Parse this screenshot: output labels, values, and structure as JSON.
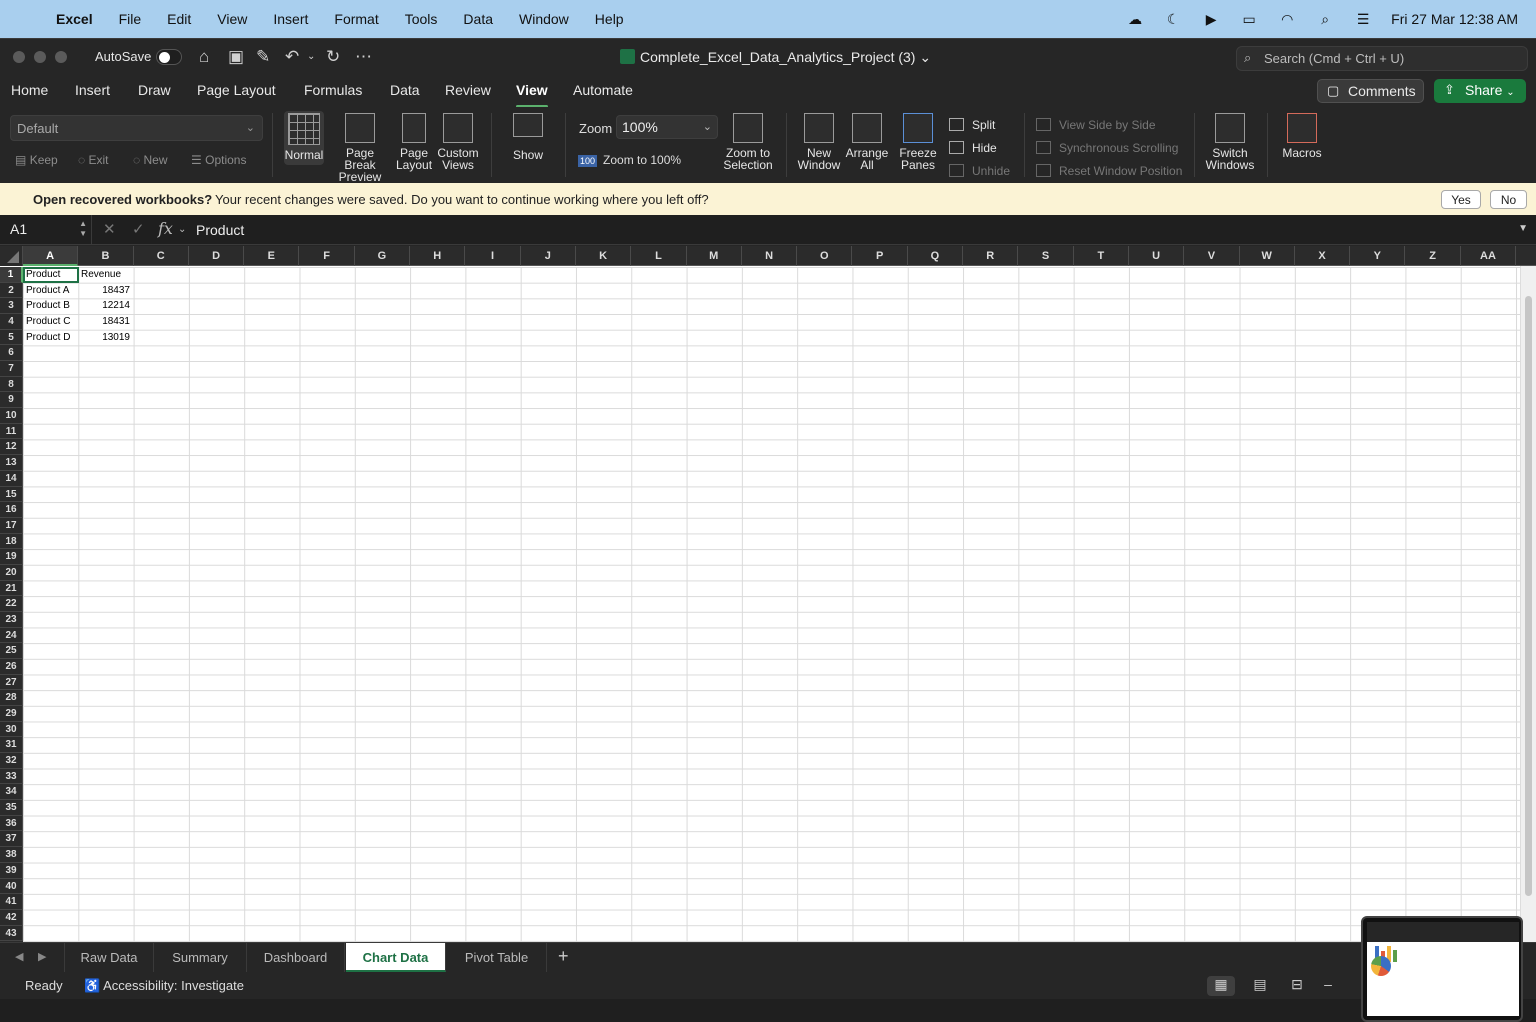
{
  "mac_menu": {
    "app": "Excel",
    "items": [
      "File",
      "Edit",
      "View",
      "Insert",
      "Format",
      "Tools",
      "Data",
      "Window",
      "Help"
    ],
    "datetime": "Fri 27 Mar  12:38 AM"
  },
  "window": {
    "autosave_label": "AutoSave",
    "title": "Complete_Excel_Data_Analytics_Project (3)",
    "search_placeholder": "Search (Cmd + Ctrl + U)"
  },
  "ribbon_tabs": [
    "Home",
    "Insert",
    "Draw",
    "Page Layout",
    "Formulas",
    "Data",
    "Review",
    "View",
    "Automate"
  ],
  "active_tab": "View",
  "actions": {
    "comments": "Comments",
    "share": "Share"
  },
  "ribbon": {
    "sheet_view": "Default",
    "keep": "Keep",
    "exit": "Exit",
    "new": "New",
    "options": "Options",
    "normal": "Normal",
    "page_break_1": "Page Break",
    "page_break_2": "Preview",
    "page_layout_1": "Page",
    "page_layout_2": "Layout",
    "custom_views_1": "Custom",
    "custom_views_2": "Views",
    "show": "Show",
    "zoom_label": "Zoom",
    "zoom_value": "100%",
    "zoom_badge": "100",
    "zoom_to_100": "Zoom to 100%",
    "zoom_sel_1": "Zoom to",
    "zoom_sel_2": "Selection",
    "new_window_1": "New",
    "new_window_2": "Window",
    "arrange_1": "Arrange",
    "arrange_2": "All",
    "freeze_1": "Freeze",
    "freeze_2": "Panes",
    "split": "Split",
    "hide": "Hide",
    "unhide": "Unhide",
    "side_by_side": "View Side by Side",
    "sync_scroll": "Synchronous Scrolling",
    "reset_position": "Reset Window Position",
    "switch_1": "Switch",
    "switch_2": "Windows",
    "macros": "Macros"
  },
  "notification": {
    "title": "Open recovered workbooks?",
    "message": "Your recent changes were saved. Do you want to continue working where you left off?",
    "yes": "Yes",
    "no": "No"
  },
  "formula_bar": {
    "cell_ref": "A1",
    "fx": "fx",
    "content": "Product"
  },
  "columns": [
    "A",
    "B",
    "C",
    "D",
    "E",
    "F",
    "G",
    "H",
    "I",
    "J",
    "K",
    "L",
    "M",
    "N",
    "O",
    "P",
    "Q",
    "R",
    "S",
    "T",
    "U",
    "V",
    "W",
    "X",
    "Y",
    "Z",
    "AA"
  ],
  "row_count": 43,
  "sheet": {
    "header": [
      "Product",
      "Revenue"
    ],
    "rows": [
      [
        "Product A",
        "18437"
      ],
      [
        "Product B",
        "12214"
      ],
      [
        "Product C",
        "18431"
      ],
      [
        "Product D",
        "13019"
      ]
    ]
  },
  "sheet_tabs": [
    "Raw Data",
    "Summary",
    "Dashboard",
    "Chart Data",
    "Pivot Table"
  ],
  "active_sheet": "Chart Data",
  "status": {
    "ready": "Ready",
    "accessibility": "Accessibility: Investigate"
  }
}
